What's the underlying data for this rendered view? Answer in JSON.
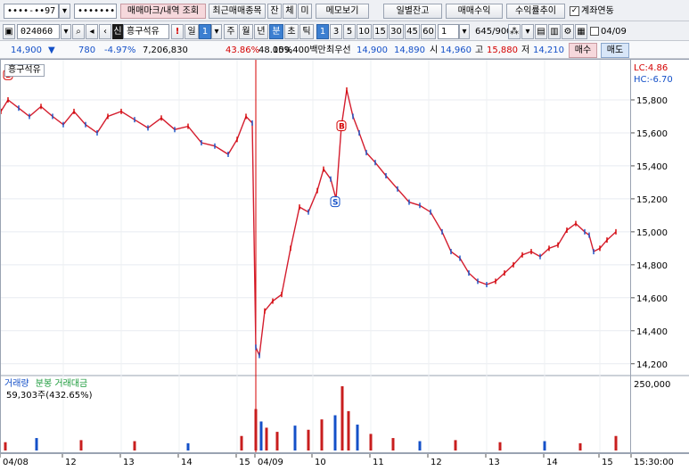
{
  "toolbar1": {
    "account": "••••-••97",
    "password": "•••••••••",
    "trade_mark_label": "매매마크/내역 조회",
    "recent_label": "최근매매종목",
    "tab_jan": "잔",
    "tab_che": "체",
    "tab_mi": "미",
    "memo_label": "메모보기",
    "daily_balance_label": "일별잔고",
    "trade_profit_label": "매매수익",
    "profit_trend_label": "수익률추이",
    "account_link_label": "계좌연동"
  },
  "toolbar2": {
    "code": "024060",
    "stock_prefix": "신",
    "stock_name": "흥구석유",
    "period_il": "일",
    "period_value": "1",
    "period_ju": "주",
    "period_wol": "월",
    "period_nyeon": "년",
    "period_bun": "분",
    "period_cho": "초",
    "period_tik": "틱",
    "intervals": [
      "1",
      "3",
      "5",
      "10",
      "15",
      "30",
      "45",
      "60"
    ],
    "interval_value": "1",
    "count": "645/900",
    "date": "04/09"
  },
  "quote": {
    "price": "14,900",
    "down_arrow": "▼",
    "change": "780",
    "change_pct": "-4.97%",
    "volume": "7,206,830",
    "turnover_pct": "43.86%",
    "ratio": "48.05%",
    "amount": "109,400백만",
    "best_label": "최우선",
    "best_ask": "14,900",
    "best_bid": "14,890",
    "open_label": "시",
    "open": "14,960",
    "high_label": "고",
    "high": "15,880",
    "low_label": "저",
    "low": "14,210",
    "buy_label": "매수",
    "sell_label": "매도"
  },
  "colors": {
    "up": "#d40000",
    "down": "#1450c8",
    "accent": "#3c7fd1",
    "volume": "#c81e1e"
  },
  "chart_data": {
    "type": "line",
    "title": "흥구석유",
    "y_ticks": [
      15800,
      15600,
      15400,
      15200,
      15000,
      14800,
      14600,
      14400,
      14200
    ],
    "y_tick_labels": [
      "15,800",
      "15,600",
      "15,400",
      "15,200",
      "15,000",
      "14,800",
      "14,600",
      "14,400",
      "14,200"
    ],
    "ylim": [
      14150,
      16000
    ],
    "lc_label": "LC:4.86",
    "hc_label": "HC:-6.70",
    "x_labels": [
      "04/08",
      "12",
      "13",
      "14",
      "15",
      "04/09",
      "10",
      "11",
      "12",
      "13",
      "14",
      "15",
      "15:30:00"
    ],
    "x_label_pos": [
      0,
      70,
      135,
      200,
      265,
      286,
      350,
      415,
      480,
      545,
      610,
      672,
      708
    ],
    "day_break_x": 286,
    "series": [
      {
        "name": "흥구석유",
        "x": [
          0,
          8,
          20,
          32,
          45,
          58,
          70,
          82,
          95,
          108,
          120,
          135,
          150,
          165,
          180,
          195,
          210,
          225,
          240,
          255,
          265,
          275,
          282,
          286,
          290,
          296,
          305,
          315,
          325,
          335,
          345,
          355,
          362,
          370,
          376,
          382,
          388,
          395,
          402,
          410,
          420,
          432,
          445,
          458,
          470,
          482,
          495,
          505,
          515,
          525,
          535,
          545,
          555,
          565,
          575,
          585,
          595,
          605,
          615,
          625,
          635,
          645,
          655,
          660,
          665,
          672,
          680,
          690
        ],
        "y": [
          15730,
          15800,
          15750,
          15700,
          15760,
          15700,
          15650,
          15730,
          15650,
          15600,
          15700,
          15730,
          15680,
          15630,
          15690,
          15620,
          15640,
          15540,
          15520,
          15470,
          15560,
          15700,
          15660,
          14300,
          14250,
          14520,
          14580,
          14620,
          14900,
          15150,
          15120,
          15250,
          15380,
          15320,
          15200,
          15640,
          15860,
          15700,
          15600,
          15480,
          15420,
          15340,
          15260,
          15180,
          15160,
          15120,
          15000,
          14880,
          14840,
          14750,
          14700,
          14680,
          14700,
          14750,
          14800,
          14860,
          14880,
          14850,
          14900,
          14920,
          15010,
          15050,
          15000,
          14980,
          14880,
          14900,
          14950,
          15000
        ]
      },
      {
        "name": "거래량",
        "x": [
          5,
          40,
          90,
          150,
          210,
          270,
          286,
          292,
          298,
          310,
          330,
          345,
          360,
          375,
          383,
          390,
          400,
          415,
          440,
          470,
          510,
          560,
          610,
          650,
          690
        ],
        "y": [
          8,
          12,
          10,
          9,
          7,
          14,
          40,
          28,
          22,
          18,
          24,
          20,
          30,
          34,
          62,
          38,
          25,
          16,
          12,
          9,
          10,
          8,
          9,
          7,
          14
        ]
      }
    ],
    "markers": [
      {
        "label": "B",
        "x": 8,
        "y": 15950
      },
      {
        "label": "B",
        "x": 382,
        "y": 15640
      },
      {
        "label": "S",
        "x": 375,
        "y": 15180
      }
    ],
    "volume_label": "거래량",
    "volume_amount_label": "분봉 거래대금",
    "volume_value": "59,303주(432.65%)",
    "volume_tick": "250,000",
    "volume_max": 250000
  }
}
